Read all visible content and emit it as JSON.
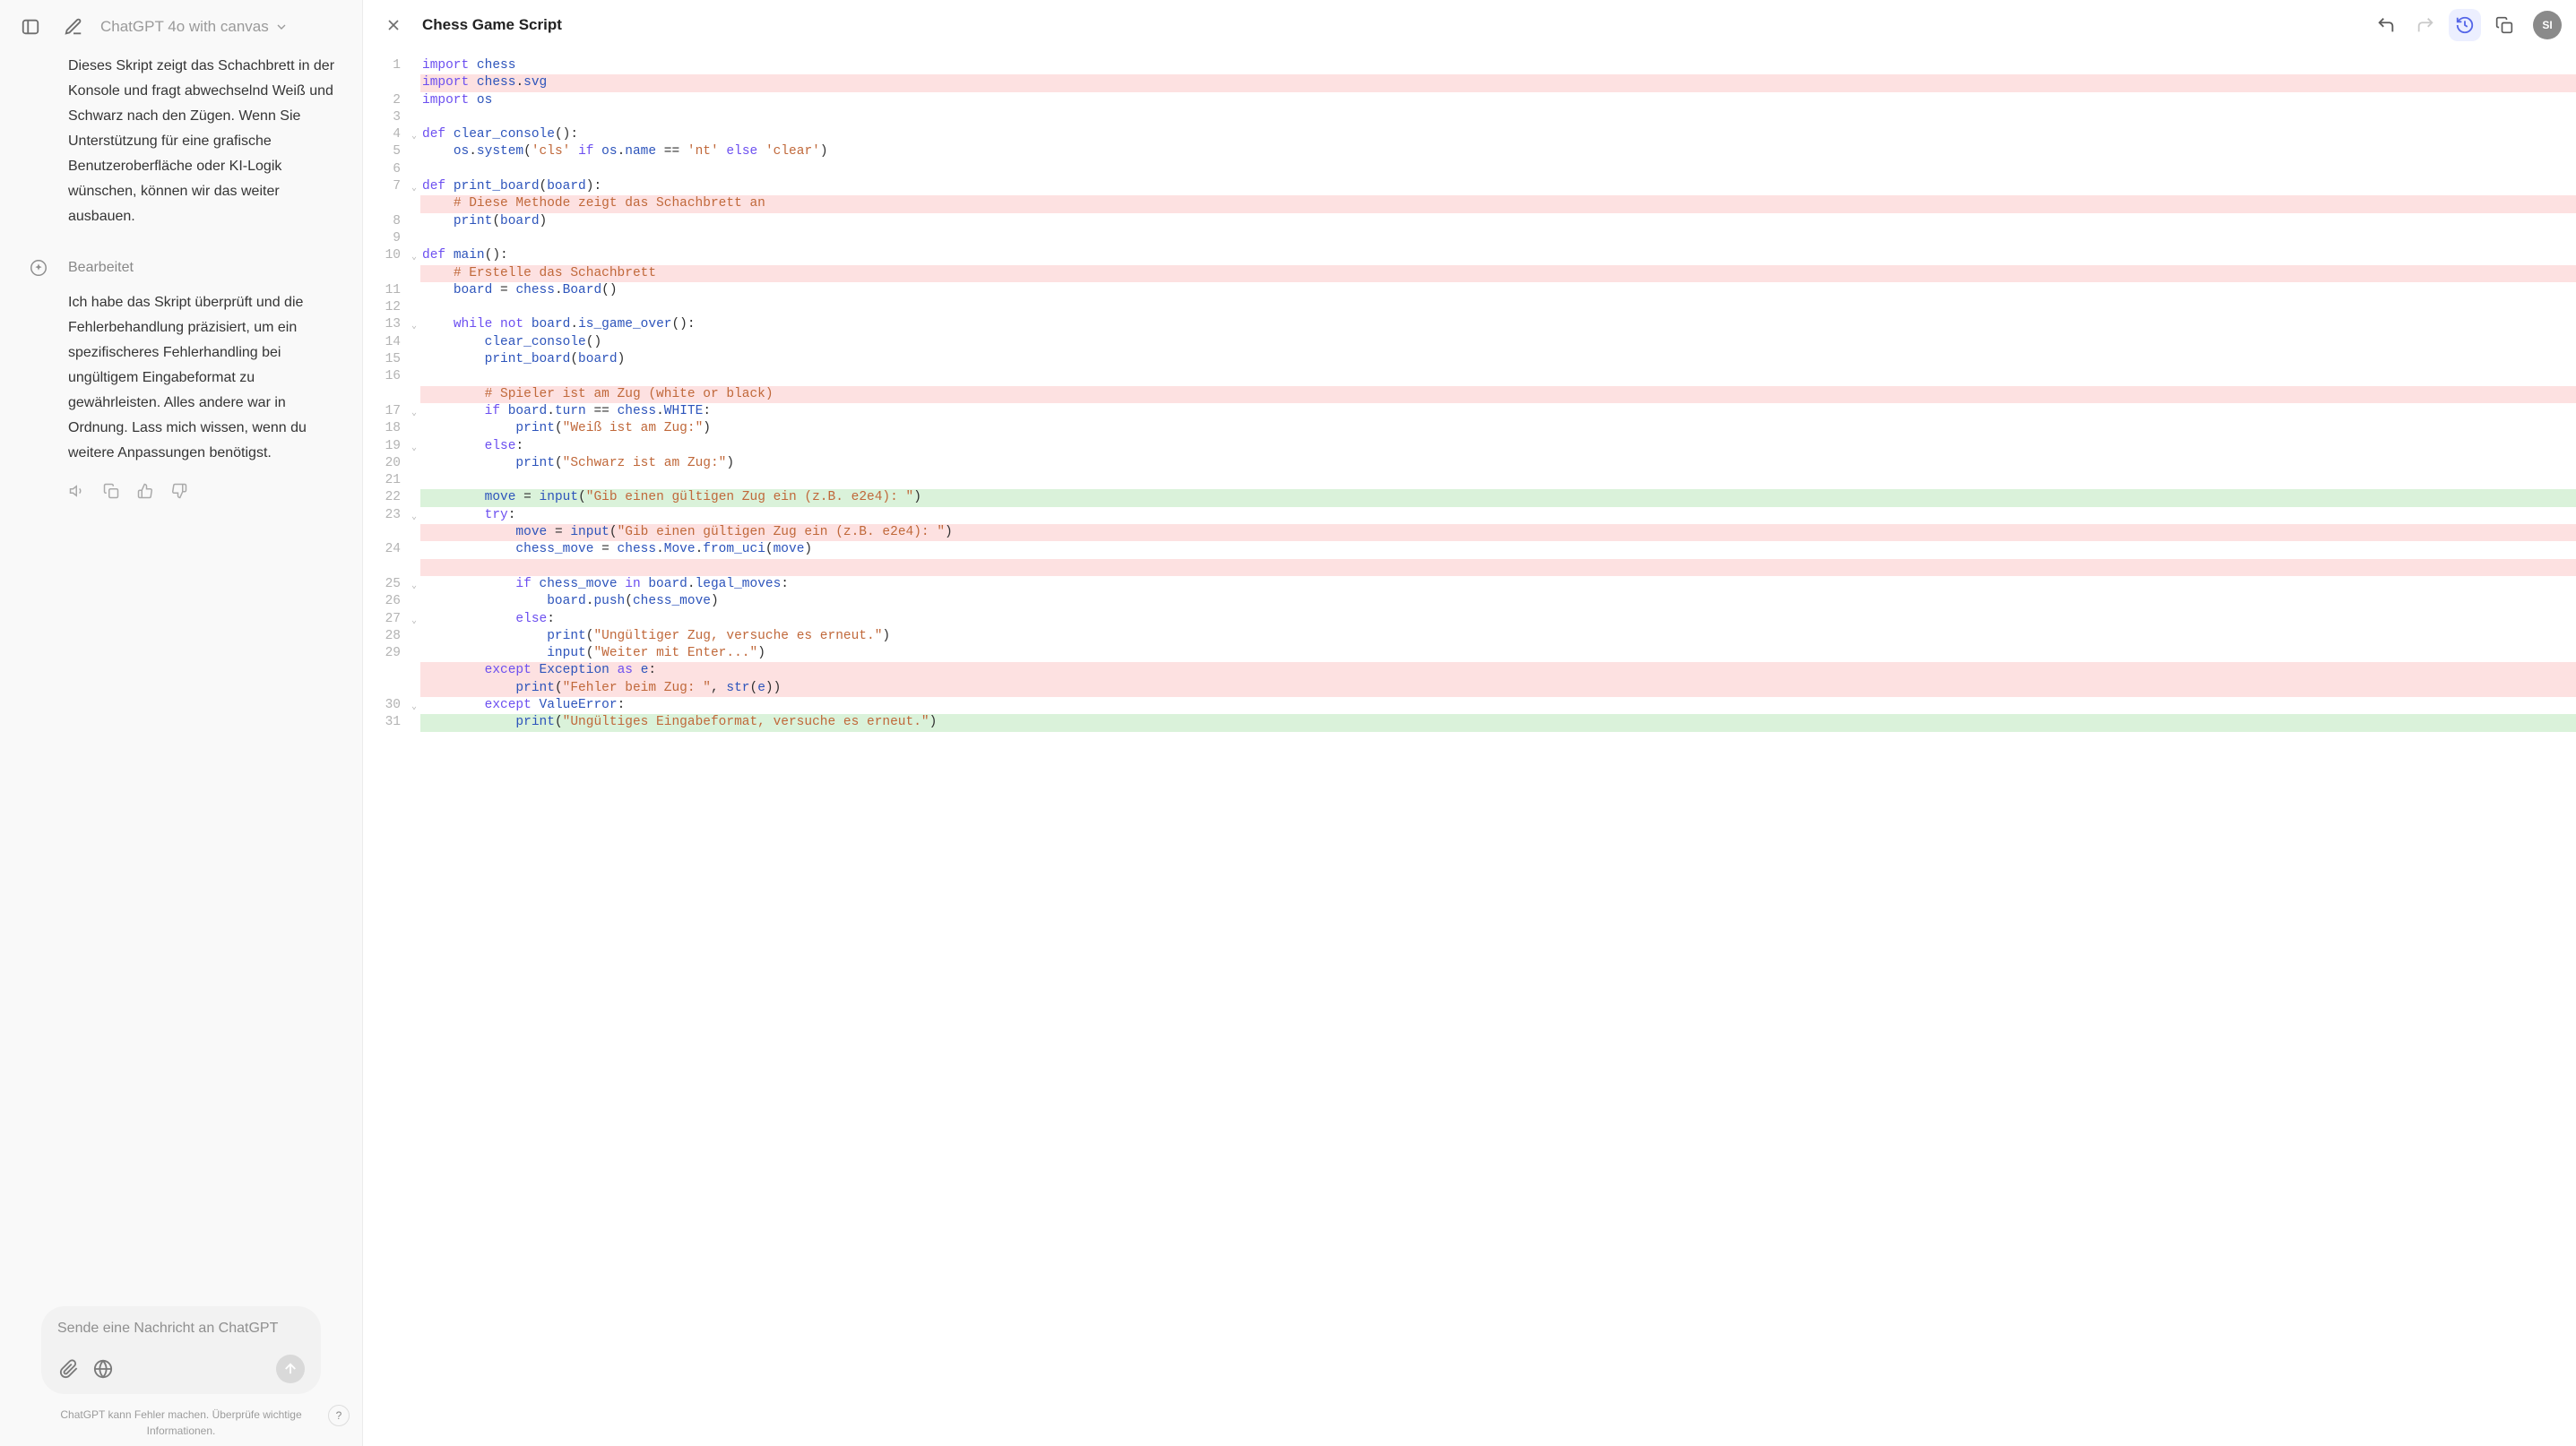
{
  "sidebar": {
    "model": "ChatGPT 4o with canvas",
    "chat1": "Dieses Skript zeigt das Schachbrett in der Konsole und fragt abwechselnd Weiß und Schwarz nach den Zügen. Wenn Sie Unterstützung für eine grafische Benutzeroberfläche oder KI-Logik wünschen, können wir das weiter ausbauen.",
    "edited_label": "Bearbeitet",
    "chat2": "Ich habe das Skript überprüft und die Fehlerbehandlung präzisiert, um ein spezifischeres Fehlerhandling bei ungültigem Eingabeformat zu gewährleisten. Alles andere war in Ordnung. Lass mich wissen, wenn du weitere Anpassungen benötigst.",
    "composer_placeholder": "Sende eine Nachricht an ChatGPT",
    "disclaimer": "ChatGPT kann Fehler machen. Überprüfe wichtige Informationen.",
    "help": "?"
  },
  "canvas": {
    "title": "Chess Game Script",
    "avatar": "SI"
  },
  "code": {
    "gutter": [
      {
        "n": "1",
        "fold": false
      },
      {
        "n": "",
        "fold": false
      },
      {
        "n": "2",
        "fold": false
      },
      {
        "n": "3",
        "fold": false
      },
      {
        "n": "4",
        "fold": true
      },
      {
        "n": "5",
        "fold": false
      },
      {
        "n": "6",
        "fold": false
      },
      {
        "n": "7",
        "fold": true
      },
      {
        "n": "",
        "fold": false
      },
      {
        "n": "8",
        "fold": false
      },
      {
        "n": "9",
        "fold": false
      },
      {
        "n": "10",
        "fold": true
      },
      {
        "n": "",
        "fold": false
      },
      {
        "n": "11",
        "fold": false
      },
      {
        "n": "12",
        "fold": false
      },
      {
        "n": "13",
        "fold": true
      },
      {
        "n": "14",
        "fold": false
      },
      {
        "n": "15",
        "fold": false
      },
      {
        "n": "16",
        "fold": false
      },
      {
        "n": "",
        "fold": false
      },
      {
        "n": "17",
        "fold": true
      },
      {
        "n": "18",
        "fold": false
      },
      {
        "n": "19",
        "fold": true
      },
      {
        "n": "20",
        "fold": false
      },
      {
        "n": "21",
        "fold": false
      },
      {
        "n": "22",
        "fold": false
      },
      {
        "n": "23",
        "fold": true
      },
      {
        "n": "",
        "fold": false
      },
      {
        "n": "24",
        "fold": false
      },
      {
        "n": "",
        "fold": false
      },
      {
        "n": "25",
        "fold": true
      },
      {
        "n": "26",
        "fold": false
      },
      {
        "n": "27",
        "fold": true
      },
      {
        "n": "28",
        "fold": false
      },
      {
        "n": "29",
        "fold": false
      },
      {
        "n": "",
        "fold": false
      },
      {
        "n": "",
        "fold": false
      },
      {
        "n": "30",
        "fold": true
      },
      {
        "n": "31",
        "fold": false
      }
    ],
    "lines": [
      {
        "hl": "",
        "tokens": [
          [
            "kw",
            "import"
          ],
          [
            "txt",
            " "
          ],
          [
            "attr",
            "chess"
          ]
        ]
      },
      {
        "hl": "red",
        "tokens": [
          [
            "kw",
            "import"
          ],
          [
            "txt",
            " "
          ],
          [
            "attr",
            "chess"
          ],
          [
            "op",
            "."
          ],
          [
            "attr",
            "svg"
          ]
        ]
      },
      {
        "hl": "",
        "tokens": [
          [
            "kw",
            "import"
          ],
          [
            "txt",
            " "
          ],
          [
            "attr",
            "os"
          ]
        ]
      },
      {
        "hl": "",
        "tokens": []
      },
      {
        "hl": "",
        "tokens": [
          [
            "kw",
            "def"
          ],
          [
            "txt",
            " "
          ],
          [
            "fn",
            "clear_console"
          ],
          [
            "op",
            "():"
          ]
        ]
      },
      {
        "hl": "",
        "tokens": [
          [
            "txt",
            "    "
          ],
          [
            "attr",
            "os"
          ],
          [
            "op",
            "."
          ],
          [
            "fn",
            "system"
          ],
          [
            "op",
            "("
          ],
          [
            "str",
            "'cls'"
          ],
          [
            "txt",
            " "
          ],
          [
            "kw",
            "if"
          ],
          [
            "txt",
            " "
          ],
          [
            "attr",
            "os"
          ],
          [
            "op",
            "."
          ],
          [
            "attr",
            "name"
          ],
          [
            "txt",
            " "
          ],
          [
            "op",
            "=="
          ],
          [
            "txt",
            " "
          ],
          [
            "str",
            "'nt'"
          ],
          [
            "txt",
            " "
          ],
          [
            "kw",
            "else"
          ],
          [
            "txt",
            " "
          ],
          [
            "str",
            "'clear'"
          ],
          [
            "op",
            ")"
          ]
        ]
      },
      {
        "hl": "",
        "tokens": []
      },
      {
        "hl": "",
        "tokens": [
          [
            "kw",
            "def"
          ],
          [
            "txt",
            " "
          ],
          [
            "fn",
            "print_board"
          ],
          [
            "op",
            "("
          ],
          [
            "param",
            "board"
          ],
          [
            "op",
            "):"
          ]
        ]
      },
      {
        "hl": "red",
        "tokens": [
          [
            "txt",
            "    "
          ],
          [
            "cm",
            "# Diese Methode zeigt das Schachbrett an"
          ]
        ]
      },
      {
        "hl": "",
        "tokens": [
          [
            "txt",
            "    "
          ],
          [
            "fn",
            "print"
          ],
          [
            "op",
            "("
          ],
          [
            "param",
            "board"
          ],
          [
            "op",
            ")"
          ]
        ]
      },
      {
        "hl": "",
        "tokens": []
      },
      {
        "hl": "",
        "tokens": [
          [
            "kw",
            "def"
          ],
          [
            "txt",
            " "
          ],
          [
            "fn",
            "main"
          ],
          [
            "op",
            "():"
          ]
        ]
      },
      {
        "hl": "red",
        "tokens": [
          [
            "txt",
            "    "
          ],
          [
            "cm",
            "# Erstelle das Schachbrett"
          ]
        ]
      },
      {
        "hl": "",
        "tokens": [
          [
            "txt",
            "    "
          ],
          [
            "attr",
            "board"
          ],
          [
            "txt",
            " "
          ],
          [
            "op",
            "="
          ],
          [
            "txt",
            " "
          ],
          [
            "attr",
            "chess"
          ],
          [
            "op",
            "."
          ],
          [
            "fn",
            "Board"
          ],
          [
            "op",
            "()"
          ]
        ]
      },
      {
        "hl": "",
        "tokens": []
      },
      {
        "hl": "",
        "tokens": [
          [
            "txt",
            "    "
          ],
          [
            "kw",
            "while"
          ],
          [
            "txt",
            " "
          ],
          [
            "kw",
            "not"
          ],
          [
            "txt",
            " "
          ],
          [
            "attr",
            "board"
          ],
          [
            "op",
            "."
          ],
          [
            "fn",
            "is_game_over"
          ],
          [
            "op",
            "():"
          ]
        ]
      },
      {
        "hl": "",
        "tokens": [
          [
            "txt",
            "        "
          ],
          [
            "fn",
            "clear_console"
          ],
          [
            "op",
            "()"
          ]
        ]
      },
      {
        "hl": "",
        "tokens": [
          [
            "txt",
            "        "
          ],
          [
            "fn",
            "print_board"
          ],
          [
            "op",
            "("
          ],
          [
            "param",
            "board"
          ],
          [
            "op",
            ")"
          ]
        ]
      },
      {
        "hl": "",
        "tokens": []
      },
      {
        "hl": "red",
        "tokens": [
          [
            "txt",
            "        "
          ],
          [
            "cm",
            "# Spieler ist am Zug (white or black)"
          ]
        ]
      },
      {
        "hl": "",
        "tokens": [
          [
            "txt",
            "        "
          ],
          [
            "kw",
            "if"
          ],
          [
            "txt",
            " "
          ],
          [
            "attr",
            "board"
          ],
          [
            "op",
            "."
          ],
          [
            "attr",
            "turn"
          ],
          [
            "txt",
            " "
          ],
          [
            "op",
            "=="
          ],
          [
            "txt",
            " "
          ],
          [
            "attr",
            "chess"
          ],
          [
            "op",
            "."
          ],
          [
            "attr",
            "WHITE"
          ],
          [
            "op",
            ":"
          ]
        ]
      },
      {
        "hl": "",
        "tokens": [
          [
            "txt",
            "            "
          ],
          [
            "fn",
            "print"
          ],
          [
            "op",
            "("
          ],
          [
            "str",
            "\"Weiß ist am Zug:\""
          ],
          [
            "op",
            ")"
          ]
        ]
      },
      {
        "hl": "",
        "tokens": [
          [
            "txt",
            "        "
          ],
          [
            "kw",
            "else"
          ],
          [
            "op",
            ":"
          ]
        ]
      },
      {
        "hl": "",
        "tokens": [
          [
            "txt",
            "            "
          ],
          [
            "fn",
            "print"
          ],
          [
            "op",
            "("
          ],
          [
            "str",
            "\"Schwarz ist am Zug:\""
          ],
          [
            "op",
            ")"
          ]
        ]
      },
      {
        "hl": "",
        "tokens": []
      },
      {
        "hl": "green",
        "tokens": [
          [
            "txt",
            "        "
          ],
          [
            "attr",
            "move"
          ],
          [
            "txt",
            " "
          ],
          [
            "op",
            "="
          ],
          [
            "txt",
            " "
          ],
          [
            "fn",
            "input"
          ],
          [
            "op",
            "("
          ],
          [
            "str",
            "\"Gib einen gültigen Zug ein (z.B. e2e4): \""
          ],
          [
            "op",
            ")"
          ]
        ]
      },
      {
        "hl": "",
        "tokens": [
          [
            "txt",
            "        "
          ],
          [
            "kw",
            "try"
          ],
          [
            "op",
            ":"
          ]
        ]
      },
      {
        "hl": "red",
        "tokens": [
          [
            "txt",
            "            "
          ],
          [
            "attr",
            "move"
          ],
          [
            "txt",
            " "
          ],
          [
            "op",
            "="
          ],
          [
            "txt",
            " "
          ],
          [
            "fn",
            "input"
          ],
          [
            "op",
            "("
          ],
          [
            "str",
            "\"Gib einen gültigen Zug ein (z.B. e2e4): \""
          ],
          [
            "op",
            ")"
          ]
        ]
      },
      {
        "hl": "",
        "tokens": [
          [
            "txt",
            "            "
          ],
          [
            "attr",
            "chess_move"
          ],
          [
            "txt",
            " "
          ],
          [
            "op",
            "="
          ],
          [
            "txt",
            " "
          ],
          [
            "attr",
            "chess"
          ],
          [
            "op",
            "."
          ],
          [
            "attr",
            "Move"
          ],
          [
            "op",
            "."
          ],
          [
            "fn",
            "from_uci"
          ],
          [
            "op",
            "("
          ],
          [
            "param",
            "move"
          ],
          [
            "op",
            ")"
          ]
        ]
      },
      {
        "hl": "red",
        "tokens": []
      },
      {
        "hl": "",
        "tokens": [
          [
            "txt",
            "            "
          ],
          [
            "kw",
            "if"
          ],
          [
            "txt",
            " "
          ],
          [
            "attr",
            "chess_move"
          ],
          [
            "txt",
            " "
          ],
          [
            "kw",
            "in"
          ],
          [
            "txt",
            " "
          ],
          [
            "attr",
            "board"
          ],
          [
            "op",
            "."
          ],
          [
            "attr",
            "legal_moves"
          ],
          [
            "op",
            ":"
          ]
        ]
      },
      {
        "hl": "",
        "tokens": [
          [
            "txt",
            "                "
          ],
          [
            "attr",
            "board"
          ],
          [
            "op",
            "."
          ],
          [
            "fn",
            "push"
          ],
          [
            "op",
            "("
          ],
          [
            "param",
            "chess_move"
          ],
          [
            "op",
            ")"
          ]
        ]
      },
      {
        "hl": "",
        "tokens": [
          [
            "txt",
            "            "
          ],
          [
            "kw",
            "else"
          ],
          [
            "op",
            ":"
          ]
        ]
      },
      {
        "hl": "",
        "tokens": [
          [
            "txt",
            "                "
          ],
          [
            "fn",
            "print"
          ],
          [
            "op",
            "("
          ],
          [
            "str",
            "\"Ungültiger Zug, versuche es erneut.\""
          ],
          [
            "op",
            ")"
          ]
        ]
      },
      {
        "hl": "",
        "tokens": [
          [
            "txt",
            "                "
          ],
          [
            "fn",
            "input"
          ],
          [
            "op",
            "("
          ],
          [
            "str",
            "\"Weiter mit Enter...\""
          ],
          [
            "op",
            ")"
          ]
        ]
      },
      {
        "hl": "red",
        "tokens": [
          [
            "txt",
            "        "
          ],
          [
            "kw",
            "except"
          ],
          [
            "txt",
            " "
          ],
          [
            "attr",
            "Exception"
          ],
          [
            "txt",
            " "
          ],
          [
            "kw",
            "as"
          ],
          [
            "txt",
            " "
          ],
          [
            "attr",
            "e"
          ],
          [
            "op",
            ":"
          ]
        ]
      },
      {
        "hl": "red",
        "tokens": [
          [
            "txt",
            "            "
          ],
          [
            "fn",
            "print"
          ],
          [
            "op",
            "("
          ],
          [
            "str",
            "\"Fehler beim Zug: \""
          ],
          [
            "op",
            ", "
          ],
          [
            "fn",
            "str"
          ],
          [
            "op",
            "("
          ],
          [
            "param",
            "e"
          ],
          [
            "op",
            "))"
          ]
        ]
      },
      {
        "hl": "",
        "tokens": [
          [
            "txt",
            "        "
          ],
          [
            "kw",
            "except"
          ],
          [
            "txt",
            " "
          ],
          [
            "attr",
            "ValueError"
          ],
          [
            "op",
            ":"
          ]
        ]
      },
      {
        "hl": "green",
        "tokens": [
          [
            "txt",
            "            "
          ],
          [
            "fn",
            "print"
          ],
          [
            "op",
            "("
          ],
          [
            "str",
            "\"Ungültiges Eingabeformat, versuche es erneut.\""
          ],
          [
            "op",
            ")"
          ]
        ]
      }
    ]
  }
}
